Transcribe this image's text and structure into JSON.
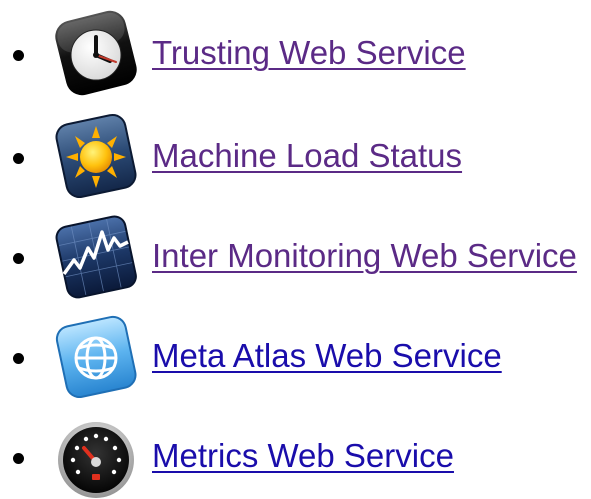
{
  "links": [
    {
      "label": "Trusting Web Service",
      "icon": "clock-icon",
      "visited": true
    },
    {
      "label": "Machine Load Status",
      "icon": "sun-icon",
      "visited": true
    },
    {
      "label": "Inter Monitoring Web Service",
      "icon": "chart-icon",
      "visited": true
    },
    {
      "label": "Meta Atlas Web Service",
      "icon": "globe-icon",
      "visited": false
    },
    {
      "label": "Metrics Web Service",
      "icon": "gauge-icon",
      "visited": false
    }
  ],
  "colors": {
    "visited_link": "#5b2a86",
    "unvisited_link": "#1a0dab"
  }
}
